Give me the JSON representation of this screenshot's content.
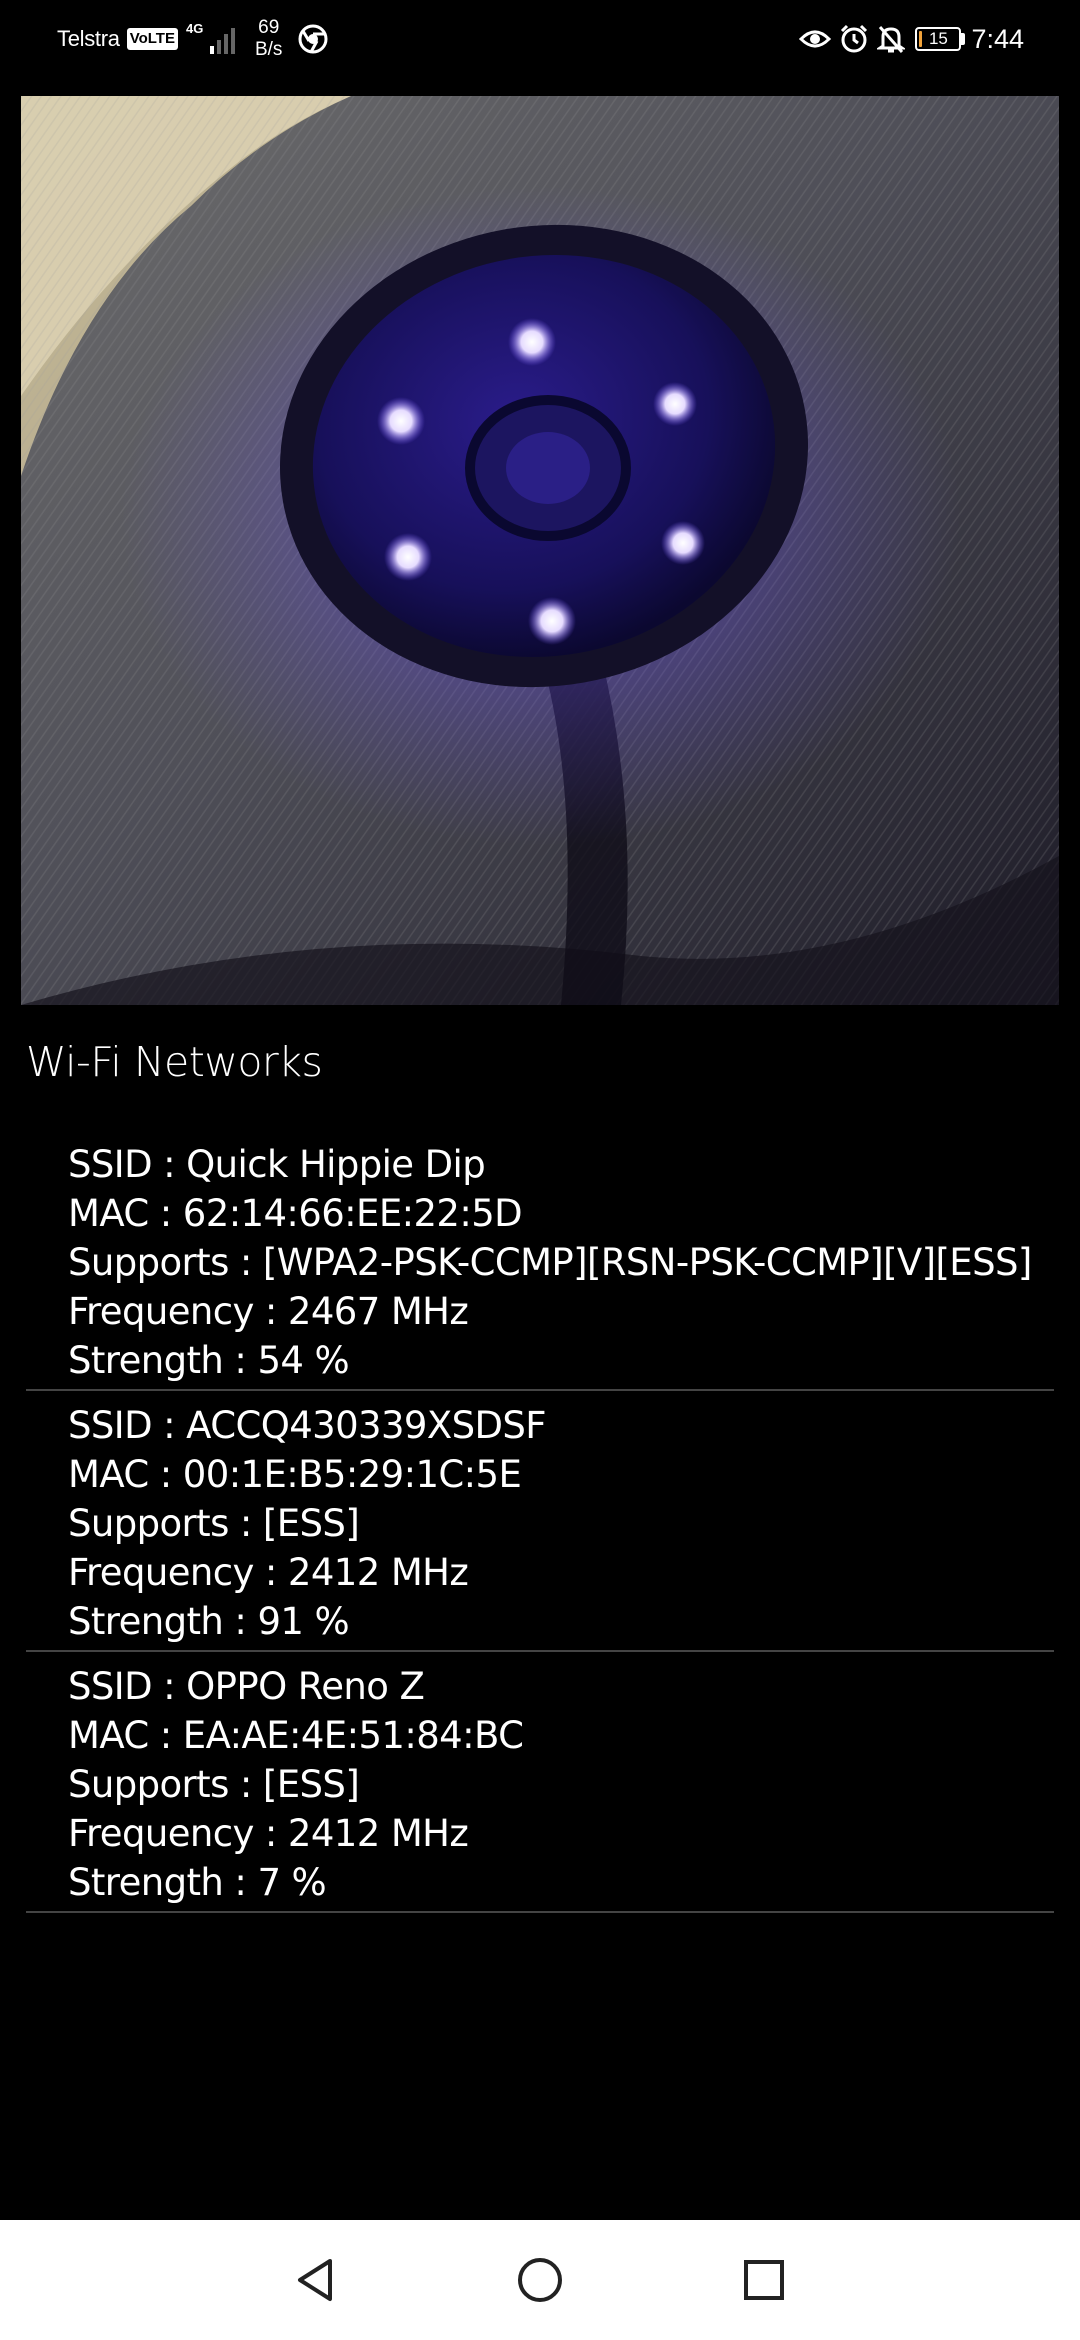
{
  "status_bar": {
    "carrier": "Telstra",
    "volte_badge": "VoLTE",
    "network_type": "4G",
    "signal_bars": 1,
    "data_speed_value": "69",
    "data_speed_unit": "B/s",
    "battery_level": "15",
    "battery_color": "#f2a33a",
    "time": "7:44",
    "icons": [
      "chrome-icon",
      "eye-icon",
      "alarm-icon",
      "bell-off-icon",
      "battery-icon"
    ]
  },
  "photo": {
    "subject": "camera-lens-with-ir-leds",
    "led_color": "#7a5cff"
  },
  "wifi_section": {
    "title": "Wi-Fi Networks",
    "networks": [
      {
        "ssid": "SSID : Quick Hippie Dip",
        "mac": "MAC : 62:14:66:EE:22:5D",
        "supports": "Supports : [WPA2-PSK-CCMP][RSN-PSK-CCMP][V][ESS]",
        "frequency": "Frequency : 2467 MHz",
        "strength": "Strength : 54 %"
      },
      {
        "ssid": "SSID : ACCQ430339XSDSF",
        "mac": "MAC : 00:1E:B5:29:1C:5E",
        "supports": "Supports : [ESS]",
        "frequency": "Frequency : 2412 MHz",
        "strength": "Strength : 91 %"
      },
      {
        "ssid": "SSID : OPPO Reno Z",
        "mac": "MAC : EA:AE:4E:51:84:BC",
        "supports": "Supports : [ESS]",
        "frequency": "Frequency : 2412 MHz",
        "strength": "Strength : 7 %"
      }
    ]
  },
  "nav_bar": {
    "buttons": [
      "back-icon",
      "home-icon",
      "recents-icon"
    ]
  }
}
